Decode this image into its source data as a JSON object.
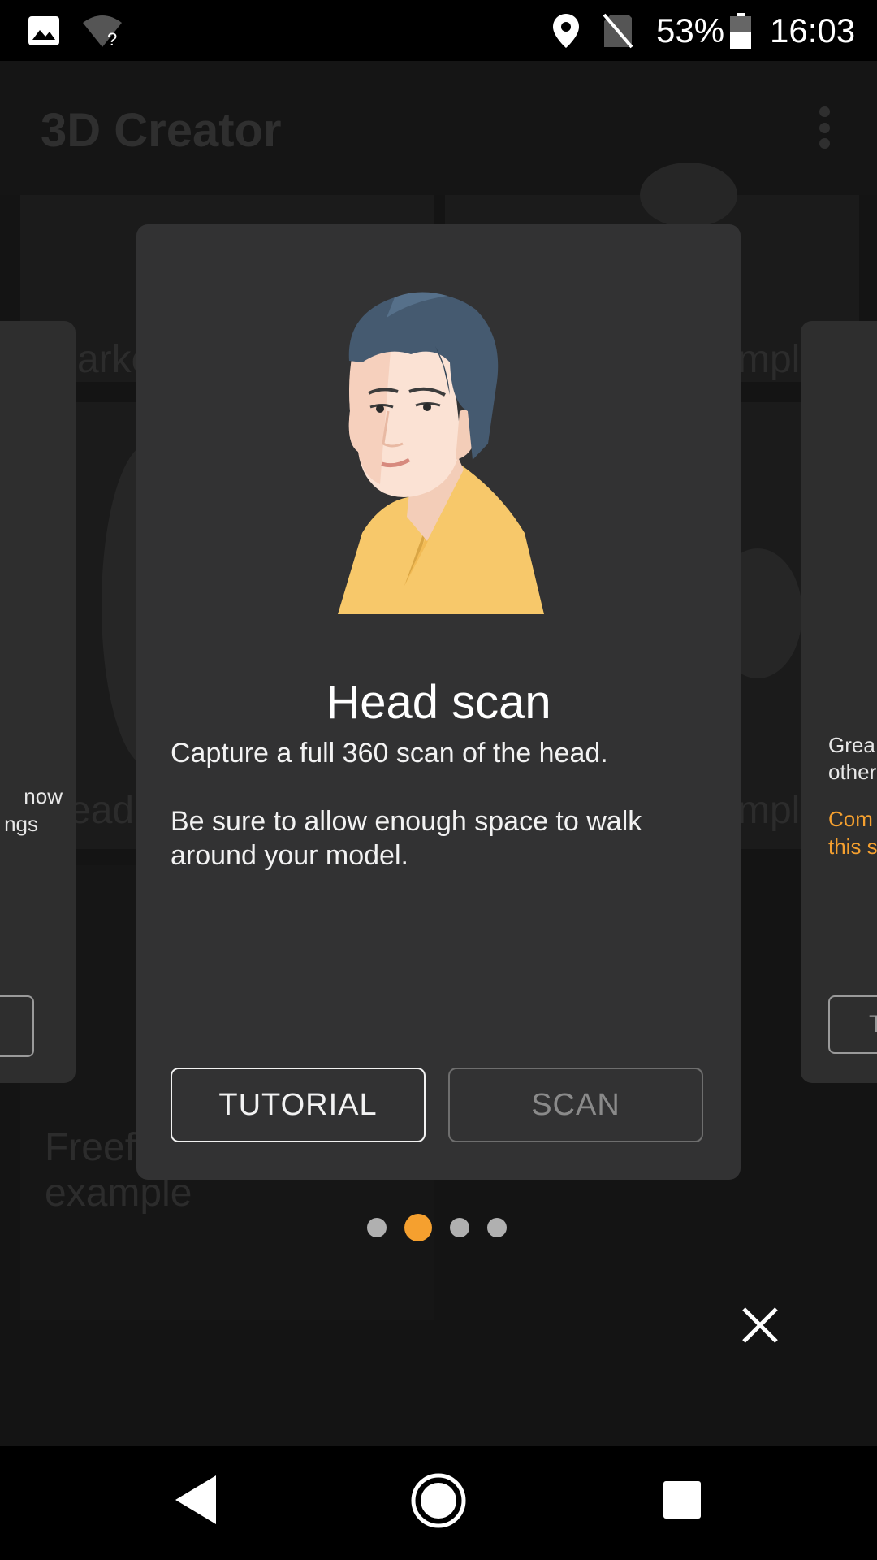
{
  "status_bar": {
    "battery": "53%",
    "time": "16:03",
    "icons": [
      "image-icon",
      "wifi-unknown-icon",
      "location-icon",
      "no-sim-icon",
      "battery-icon"
    ]
  },
  "background_app": {
    "title": "3D Creator",
    "tiles": [
      {
        "label": "Marke"
      },
      {
        "label": "mple"
      },
      {
        "label": "ead"
      },
      {
        "label": "mple"
      },
      {
        "label": "Freefo\nexample"
      }
    ]
  },
  "left_card": {
    "lines": [
      "now",
      "ngs"
    ]
  },
  "right_card": {
    "lines": [
      "Grea",
      "other"
    ],
    "orange_lines": [
      "Com",
      "this s"
    ],
    "button_partial": "T"
  },
  "dialog": {
    "title": "Head scan",
    "description_1": "Capture a full 360 scan of the head.",
    "description_2": "Be sure to allow enough space to walk around your model.",
    "tutorial_label": "TUTORIAL",
    "scan_label": "SCAN"
  },
  "pager": {
    "count": 4,
    "active_index": 1
  },
  "colors": {
    "accent": "#f5a02f",
    "dialog_bg": "#323233"
  },
  "nav_bar": {
    "icons": [
      "back-icon",
      "home-icon",
      "recents-icon"
    ]
  }
}
